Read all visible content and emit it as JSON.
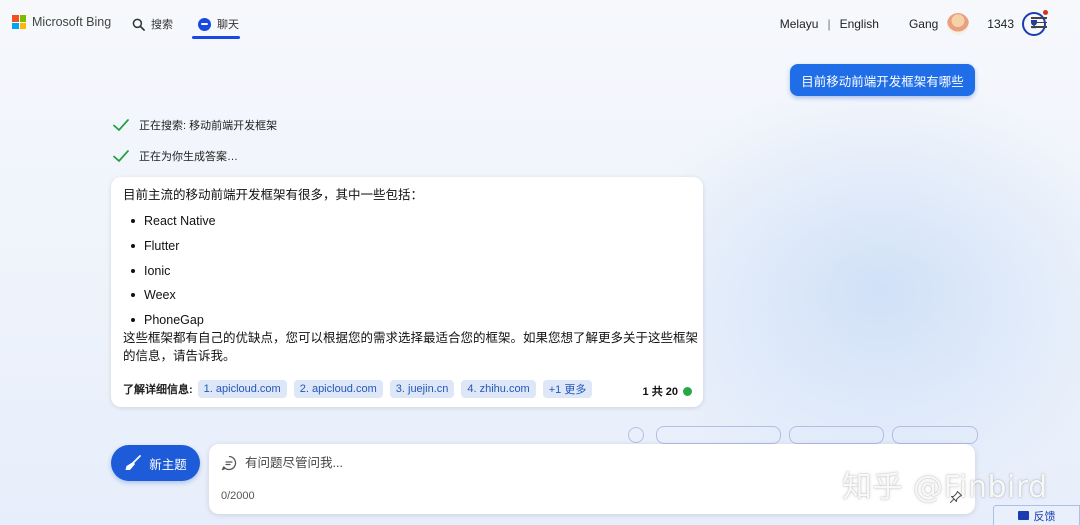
{
  "header": {
    "logo_text": "Microsoft Bing",
    "tabs": [
      {
        "label": "搜索",
        "icon": "search-icon",
        "active": false
      },
      {
        "label": "聊天",
        "icon": "chat-bubble-icon",
        "active": true
      }
    ],
    "languages": [
      "Melayu",
      "English"
    ],
    "language_separator": "|",
    "user_name": "Gang",
    "reward_points": "1343",
    "accent_color": "#174ae4"
  },
  "conversation": {
    "user_message": "目前移动前端开发框架有哪些",
    "steps": [
      {
        "text": "正在搜索: 移动前端开发框架",
        "status": "done"
      },
      {
        "text": "正在为你生成答案…",
        "status": "done"
      }
    ],
    "answer": {
      "intro": "目前主流的移动前端开发框架有很多，其中一些包括：",
      "items": [
        "React Native",
        "Flutter",
        "Ionic",
        "Weex",
        "PhoneGap"
      ],
      "outro": "这些框架都有自己的优缺点，您可以根据您的需求选择最适合您的框架。如果您想了解更多关于这些框架的信息，请告诉我。",
      "learn_more_label": "了解详细信息:",
      "citations": [
        "1. apicloud.com",
        "2. apicloud.com",
        "3. juejin.cn",
        "4. zhihu.com",
        "+1 更多"
      ],
      "turn_counter": "1 共 20",
      "status_color": "#27a845"
    }
  },
  "composer": {
    "new_topic_label": "新主题",
    "placeholder": "有问题尽管问我...",
    "char_count": "0/2000"
  },
  "watermark": "知乎 @Finbird",
  "feedback_label": "反馈"
}
